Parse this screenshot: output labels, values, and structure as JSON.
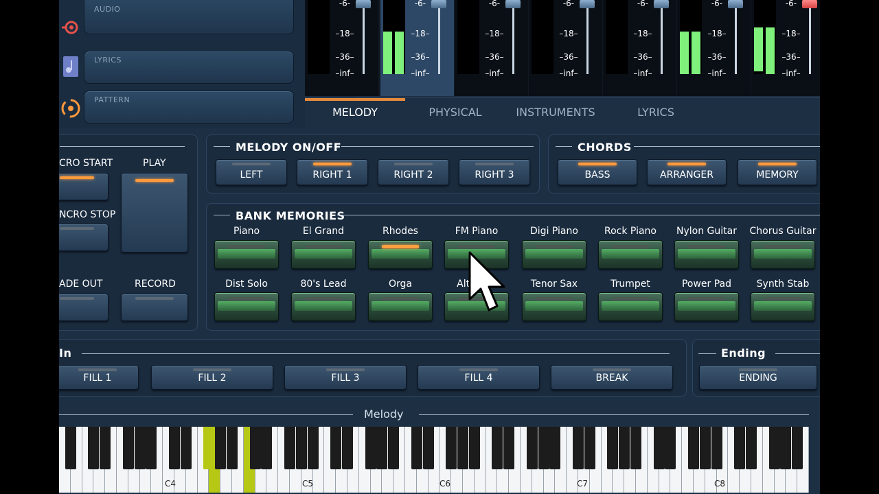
{
  "side": {
    "rows": [
      {
        "label": "AUDIO",
        "icon": "audio-icon",
        "color": "#e6524a"
      },
      {
        "label": "LYRICS",
        "icon": "music-note-icon",
        "color": "#8a9bd8"
      },
      {
        "label": "PATTERN",
        "icon": "pattern-icon",
        "color": "#ff9a3c"
      }
    ]
  },
  "mixer": {
    "scale": [
      "-6-",
      "–18–",
      "–36–",
      "–inf–"
    ]
  },
  "tabs": [
    "MELODY",
    "PHYSICAL",
    "INSTRUMENTS",
    "LYRICS"
  ],
  "control": {
    "intro_start": "CRO START",
    "play": "PLAY",
    "intro_stop": "NCRO STOP",
    "fade_out": "ADE OUT",
    "record": "RECORD"
  },
  "melody_onoff": {
    "title": "MELODY ON/OFF",
    "buttons": [
      "LEFT",
      "RIGHT 1",
      "RIGHT 2",
      "RIGHT 3"
    ]
  },
  "chords": {
    "title": "CHORDS",
    "buttons": [
      "BASS",
      "ARRANGER",
      "MEMORY"
    ]
  },
  "bank": {
    "title": "BANK MEMORIES",
    "row1": [
      "Piano",
      "El Grand",
      "Rhodes",
      "FM Piano",
      "Digi Piano",
      "Rock Piano",
      "Nylon Guitar",
      "Chorus Guitar"
    ],
    "row2": [
      "Dist Solo",
      "80's Lead",
      "Orga",
      "Alto Sax",
      "Tenor Sax",
      "Trumpet",
      "Power Pad",
      "Synth Stab"
    ]
  },
  "fills": {
    "title": "In",
    "buttons": [
      "FILL 1",
      "FILL 2",
      "FILL 3",
      "FILL 4",
      "BREAK"
    ]
  },
  "ending": {
    "title": "Ending",
    "button": "ENDING"
  },
  "piano": {
    "title": "Melody",
    "octaves": [
      "C4",
      "C5",
      "C6",
      "C7",
      "C8"
    ]
  }
}
